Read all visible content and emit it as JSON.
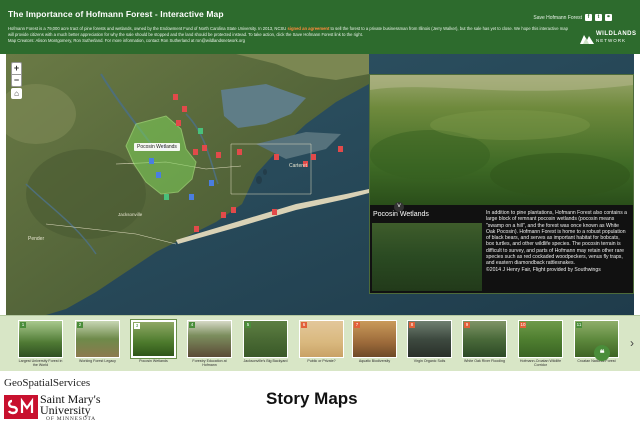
{
  "header": {
    "title": "The Importance of Hofmann Forest - Interactive Map",
    "description_before": "Hofmann Forest is a 79,000 acre tract of pine forests and wetlands, owned by the Endowment Fund of North Carolina State University. In 2013, NCSU ",
    "description_highlight": "signed an agreement",
    "description_after": " to sell the forest to a private businessman from Illinois (Jerry Walker), but the sale has yet to close. We hope this interactive map will provide citizens with a much better appreciation for why the sale should be stopped and the land should be protected instead. To take action, click the Save Hofmann Forest link to the right.",
    "credits": "Map Creators: Alison Montgomery, Ron Sutherland. For more information, contact Ron Sutherland at ron@wildlandsnetwork.org",
    "share_label": "Save Hofmann Forest",
    "share_icons": [
      "facebook-icon",
      "twitter-icon",
      "link-icon"
    ],
    "logo_line1": "WILDLANDS",
    "logo_line2": "NETWORK",
    "accent_color": "#2d6b2d",
    "highlight_color": "#ff8a3c"
  },
  "map": {
    "zoom_in": "+",
    "zoom_out": "−",
    "home_icon": "home-icon",
    "popup_label": "Pocosin Wetlands",
    "place_labels": [
      "Carteret",
      "Pender",
      "Jacksonville"
    ]
  },
  "panel": {
    "title": "Pocosin Wetlands",
    "body": "In addition to pine plantations, Hofmann Forest also contains a large block of remnant pocosin wetlands (pocosin means \"swamp on a hill\", and the forest was once known as White Oak Pocosin). Hofmann Forest is home to a robust population of black bears, and serves as important habitat for bobcats, box turtles, and other wildlife species. The pocosin terrain is difficult to survey, and parts of Hofmann may retain other rare species such as red cockaded woodpeckers, venus fly traps, and eastern diamondback rattlesnakes.",
    "credit": "©2014 J Henry Fair, Flight provided by Southwings"
  },
  "carousel": {
    "items": [
      {
        "num": "1",
        "label": "Largest University Forest in the World"
      },
      {
        "num": "2",
        "label": "Working Forest Legacy"
      },
      {
        "num": "3",
        "label": "Pocosin Wetlands"
      },
      {
        "num": "4",
        "label": "Forestry Education at Hofmann"
      },
      {
        "num": "5",
        "label": "Jacksonville's Big Backyard"
      },
      {
        "num": "6",
        "label": "Public or Private?"
      },
      {
        "num": "7",
        "label": "Aquatic Biodiversity"
      },
      {
        "num": "8",
        "label": "Virgin Organic Soils"
      },
      {
        "num": "9",
        "label": "White Oak River Flooding"
      },
      {
        "num": "10",
        "label": "Hofmann-Croatan Wildlife Corridor"
      },
      {
        "num": "11",
        "label": "Croatan National Forest"
      }
    ],
    "active_index": 2
  },
  "footer": {
    "geospatial": "GeoSpatialServices",
    "smu_line1": "Saint Mary's",
    "smu_line2": "University",
    "smu_line3": "OF MINNESOTA",
    "story_maps": "Story Maps"
  }
}
